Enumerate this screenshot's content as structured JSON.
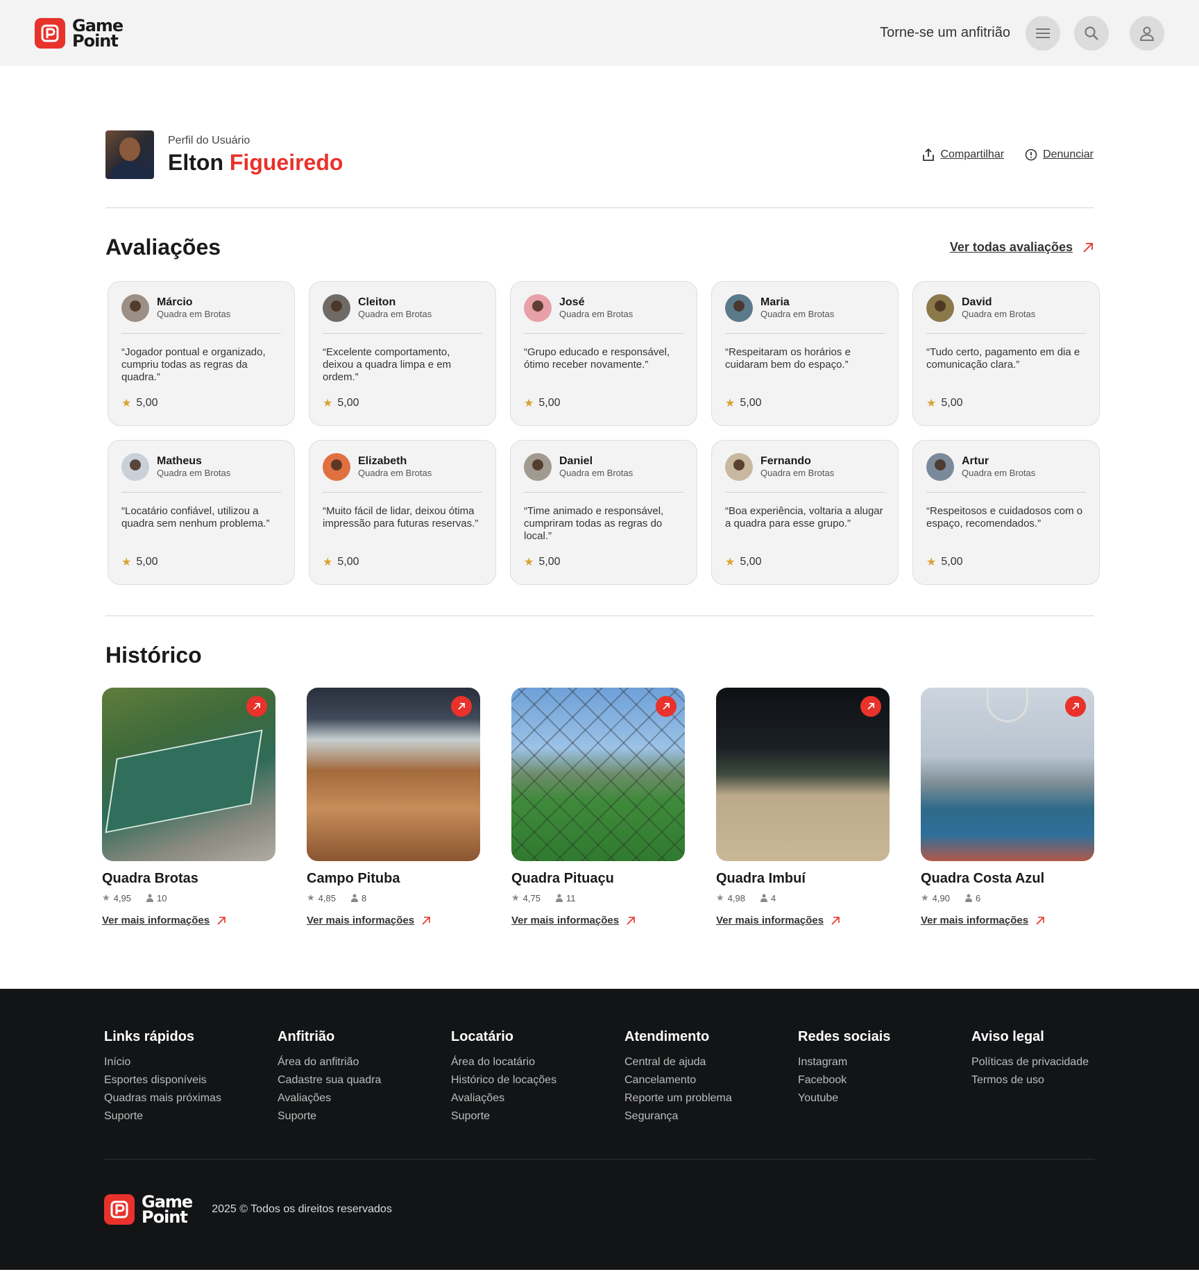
{
  "header": {
    "logo_line1": "Game",
    "logo_line2": "Point",
    "host_link": "Torne-se um anfitrião",
    "menu_icon": "menu-icon",
    "search_icon": "search-icon",
    "user_icon": "user-icon"
  },
  "profile": {
    "subtitle": "Perfil do Usuário",
    "first_name": "Elton",
    "last_name": "Figueiredo",
    "share_label": "Compartilhar",
    "report_label": "Denunciar"
  },
  "reviews": {
    "title": "Avaliações",
    "see_all": "Ver todas avaliações",
    "items": [
      {
        "name": "Márcio",
        "place": "Quadra em Brotas",
        "text": "“Jogador pontual e organizado, cumpriu todas as regras da quadra.”",
        "rating": "5,00",
        "color": "#9b8f86"
      },
      {
        "name": "Cleiton",
        "place": "Quadra em Brotas",
        "text": "“Excelente comportamento, deixou a quadra limpa e em ordem.”",
        "rating": "5,00",
        "color": "#6f6a66"
      },
      {
        "name": "José",
        "place": "Quadra em Brotas",
        "text": "“Grupo educado e responsável, ótimo receber novamente.”",
        "rating": "5,00",
        "color": "#e8a0a8"
      },
      {
        "name": "Maria",
        "place": "Quadra em Brotas",
        "text": "“Respeitaram os horários e cuidaram bem do espaço.”",
        "rating": "5,00",
        "color": "#5a7a8a"
      },
      {
        "name": "David",
        "place": "Quadra em Brotas",
        "text": "“Tudo certo, pagamento em dia e comunicação clara.”",
        "rating": "5,00",
        "color": "#8a7a4a"
      },
      {
        "name": "Matheus",
        "place": "Quadra em Brotas",
        "text": "“Locatário confiável, utilizou a quadra sem nenhum problema.”",
        "rating": "5,00",
        "color": "#c9d0d8"
      },
      {
        "name": "Elizabeth",
        "place": "Quadra em Brotas",
        "text": "“Muito fácil de lidar, deixou ótima impressão para futuras reservas.”",
        "rating": "5,00",
        "color": "#e07040"
      },
      {
        "name": "Daniel",
        "place": "Quadra em Brotas",
        "text": "“Time animado e responsável, cumpriram todas as regras do local.”",
        "rating": "5,00",
        "color": "#a09a90"
      },
      {
        "name": "Fernando",
        "place": "Quadra em Brotas",
        "text": "“Boa experiência, voltaria a alugar a quadra para esse grupo.”",
        "rating": "5,00",
        "color": "#c8b8a0"
      },
      {
        "name": "Artur",
        "place": "Quadra em Brotas",
        "text": "“Respeitosos e cuidadosos com o espaço, recomendados.”",
        "rating": "5,00",
        "color": "#7a8a9a"
      }
    ]
  },
  "history": {
    "title": "Histórico",
    "link_label": "Ver mais informações",
    "items": [
      {
        "name": "Quadra Brotas",
        "rating": "4,95",
        "people": "10"
      },
      {
        "name": "Campo Pituba",
        "rating": "4,85",
        "people": "8"
      },
      {
        "name": "Quadra Pituaçu",
        "rating": "4,75",
        "people": "11"
      },
      {
        "name": "Quadra Imbuí",
        "rating": "4,98",
        "people": "4"
      },
      {
        "name": "Quadra Costa Azul",
        "rating": "4,90",
        "people": "6"
      }
    ]
  },
  "footer": {
    "columns": [
      {
        "title": "Links rápidos",
        "links": [
          "Início",
          "Esportes disponíveis",
          "Quadras mais próximas",
          "Suporte"
        ]
      },
      {
        "title": "Anfitrião",
        "links": [
          "Área do anfitrião",
          "Cadastre sua quadra",
          "Avaliações",
          "Suporte"
        ]
      },
      {
        "title": "Locatário",
        "links": [
          "Área do locatário",
          "Histórico de locações",
          "Avaliações",
          "Suporte"
        ]
      },
      {
        "title": "Atendimento",
        "links": [
          "Central de ajuda",
          "Cancelamento",
          "Reporte um problema",
          "Segurança"
        ]
      },
      {
        "title": "Redes sociais",
        "links": [
          "Instagram",
          "Facebook",
          "Youtube"
        ]
      },
      {
        "title": "Aviso legal",
        "links": [
          "Políticas de privacidade",
          "Termos de uso"
        ]
      }
    ],
    "copyright": "2025 © Todos os direitos reservados"
  },
  "colors": {
    "accent": "#e8322b",
    "star": "#d9a233",
    "footer_bg": "#121416"
  }
}
